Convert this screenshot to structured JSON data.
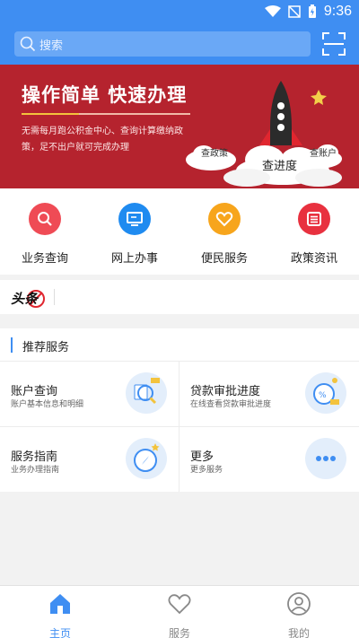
{
  "status": {
    "time": "9:36"
  },
  "search": {
    "placeholder": "搜索"
  },
  "banner": {
    "title": "操作简单 快速办理",
    "subtitle": "无需每月跑公积金中心、查询计算缴纳政策，足不出户就可完成办理",
    "clouds": [
      "查政策",
      "查进度",
      "查账户"
    ]
  },
  "quick_actions": [
    {
      "label": "业务查询",
      "color": "#ef4b55",
      "icon": "search-icon"
    },
    {
      "label": "网上办事",
      "color": "#1f8bf0",
      "icon": "computer-icon"
    },
    {
      "label": "便民服务",
      "color": "#f7a51c",
      "icon": "heart-icon"
    },
    {
      "label": "政策资讯",
      "color": "#e8313f",
      "icon": "document-icon"
    }
  ],
  "headline": {
    "logo": "头条"
  },
  "recommended": {
    "title": "推荐服务",
    "items": [
      {
        "title": "账户查询",
        "subtitle": "账户基本信息和明细",
        "icon": "magnifier-icon"
      },
      {
        "title": "贷款审批进度",
        "subtitle": "在线查看贷款审批进度",
        "icon": "progress-icon"
      },
      {
        "title": "服务指南",
        "subtitle": "业务办理指南",
        "icon": "compass-icon"
      },
      {
        "title": "更多",
        "subtitle": "更多服务",
        "icon": "more-icon"
      }
    ]
  },
  "bottom_nav": [
    {
      "label": "主页",
      "active": true
    },
    {
      "label": "服务",
      "active": false
    },
    {
      "label": "我的",
      "active": false
    }
  ],
  "colors": {
    "primary": "#3f8ef2",
    "banner": "#b5232e",
    "inactive": "#888888"
  }
}
